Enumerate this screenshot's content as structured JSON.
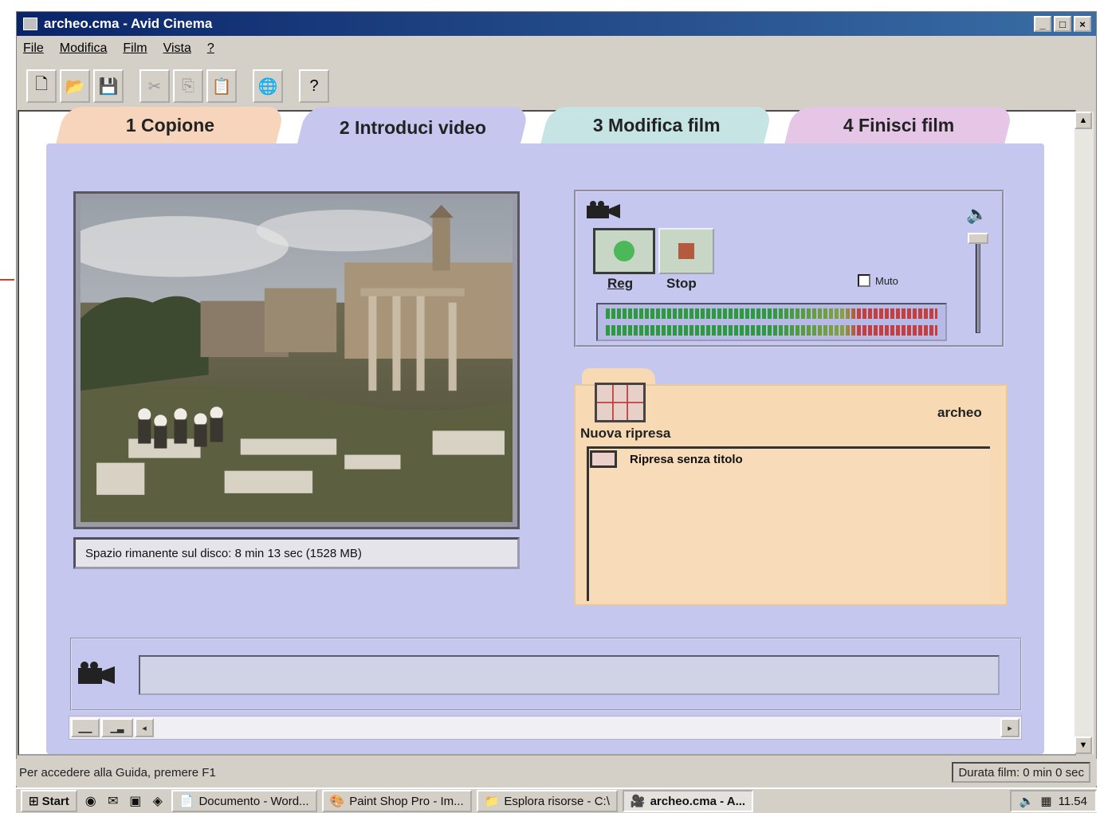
{
  "window": {
    "title": "archeo.cma - Avid Cinema",
    "controls": [
      "_",
      "□",
      "×"
    ]
  },
  "menu": [
    "File",
    "Modifica",
    "Film",
    "Vista",
    "?"
  ],
  "toolbar": {
    "icons": [
      "new-icon",
      "open-icon",
      "save-icon",
      "cut-icon",
      "copy-icon",
      "paste-icon",
      "web-icon",
      "help-icon"
    ],
    "glyphs": [
      "🗋",
      "📂",
      "💾",
      "✂",
      "⎘",
      "📋",
      "🌐",
      "?"
    ]
  },
  "tabs": [
    {
      "label": "1 Copione",
      "color": "#f7d5bc"
    },
    {
      "label": "2 Introduci video",
      "color": "#c6c6ee"
    },
    {
      "label": "3 Modifica film",
      "color": "#c7e4e4"
    },
    {
      "label": "4 Finisci film",
      "color": "#e6c6e6"
    }
  ],
  "preview": {
    "scene": "Roman Forum with ruins, columns and visitors",
    "disk_status": "Spazio rimanente sul disco: 8 min 13 sec (1528 MB)"
  },
  "capture": {
    "rec_label": "Reg",
    "stop_label": "Stop",
    "mute_label": "Muto",
    "mute_checked": false,
    "volume_icon": "speaker-icon",
    "volume_glyph": "🔈"
  },
  "clips": {
    "project_name": "archeo",
    "new_shot_label": "Nuova ripresa",
    "shots": [
      "Ripresa senza titolo"
    ]
  },
  "statusbar": {
    "help_text": "Per accedere alla Guida, premere F1",
    "duration_text": "Durata film: 0 min 0 sec"
  },
  "taskbar": {
    "start_label": "Start",
    "tasks": [
      "Documento - Word...",
      "Paint Shop Pro - Im...",
      "Esplora risorse - C:\\",
      "archeo.cma - A..."
    ],
    "clock": "11.54"
  },
  "colors": {
    "titlebar": "#0a246a",
    "panel": "#c5c7ee",
    "clips_panel": "#f7d9b4",
    "rec_green": "#4cb85a",
    "stop_red": "#b45a3e"
  }
}
